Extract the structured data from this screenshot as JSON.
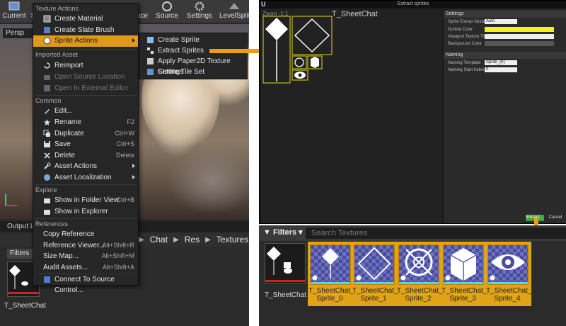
{
  "toolbar": {
    "items": [
      {
        "label": "Current"
      },
      {
        "label": "S"
      },
      {
        "label": "ace"
      },
      {
        "label": "Source"
      },
      {
        "label": "Settings"
      },
      {
        "label": "LevelSplit"
      }
    ]
  },
  "viewport": {
    "tab_label": "Persp"
  },
  "output_bar": {
    "label": "Output Lo"
  },
  "content_browser_left": {
    "filters_label": "Filters",
    "path": [
      "Chat",
      "Res",
      "Textures"
    ],
    "asset_name": "T_SheetChat"
  },
  "context_menu": {
    "sections": {
      "texture_actions": "Texture Actions",
      "imported_asset": "Imported Asset",
      "common": "Common",
      "explore": "Explore",
      "references": "References"
    },
    "items": {
      "create_material": "Create Material",
      "create_slate_brush": "Create Slate Brush",
      "sprite_actions": "Sprite Actions",
      "reimport": "Reimport",
      "open_source_location": "Open Source Location",
      "open_external_editor": "Open In External Editor",
      "edit": "Edit...",
      "rename": "Rename",
      "duplicate": "Duplicate",
      "save": "Save",
      "delete": "Delete",
      "asset_actions": "Asset Actions",
      "asset_localization": "Asset Localization",
      "show_in_folder_view": "Show in Folder View",
      "show_in_explorer": "Show in Explorer",
      "copy_reference": "Copy Reference",
      "reference_viewer": "Reference Viewer...",
      "size_map": "Size Map...",
      "audit_assets": "Audit Assets...",
      "connect_source_control": "Connect To Source Control..."
    },
    "shortcuts": {
      "rename": "F2",
      "duplicate": "Ctrl+W",
      "save": "Ctrl+S",
      "delete": "Delete",
      "show_in_folder_view": "Ctrl+B",
      "reference_viewer": "Alt+Shift+R",
      "size_map": "Alt+Shift+M",
      "audit_assets": "Alt+Shift+A"
    }
  },
  "submenu": {
    "create_sprite": "Create Sprite",
    "extract_sprites": "Extract Sprites",
    "apply_paper2d": "Apply Paper2D Texture Settings",
    "create_tile_set": "Create Tile Set"
  },
  "dialog": {
    "title": "Extract sprites",
    "zoom_label": "Zoom -1:1",
    "canvas_title": "T_SheetChat",
    "settings_header": "Settings",
    "naming_header": "Naming",
    "rows": {
      "extract_mode_label": "Sprite Extract Mode",
      "extract_mode_value": "Auto",
      "outline_color_label": "Outline Color",
      "viewport_tint_label": "Viewport Texture Tint",
      "background_color_label": "Background Color",
      "naming_template_label": "Naming Template",
      "naming_template_value": "Sprite_{0}",
      "naming_start_label": "Naming Start Index",
      "naming_start_value": "0"
    },
    "extract_button": "Extract...",
    "cancel_button": "Cancel"
  },
  "content_browser_right": {
    "filters_label": "Filters",
    "search_placeholder": "Search Textures",
    "source_name": "T_SheetChat",
    "sprites": [
      {
        "name": "T_SheetChat_",
        "index_label": "Sprite_0",
        "icon": "diamond-icon"
      },
      {
        "name": "T_SheetChat_",
        "index_label": "Sprite_1",
        "icon": "diamond-outline-icon"
      },
      {
        "name": "T_SheetChat_",
        "index_label": "Sprite_2",
        "icon": "crosshair-icon"
      },
      {
        "name": "T_SheetChat_",
        "index_label": "Sprite_3",
        "icon": "cube-icon"
      },
      {
        "name": "T_SheetChat_",
        "index_label": "Sprite_4",
        "icon": "eye-icon"
      }
    ]
  },
  "colors": {
    "highlight": "#e09a1a",
    "selection": "#e1a318",
    "outline_color_value": "#f2f21a",
    "extract_button": "#36a83a",
    "sprite_bg": "#4a4e9a"
  }
}
